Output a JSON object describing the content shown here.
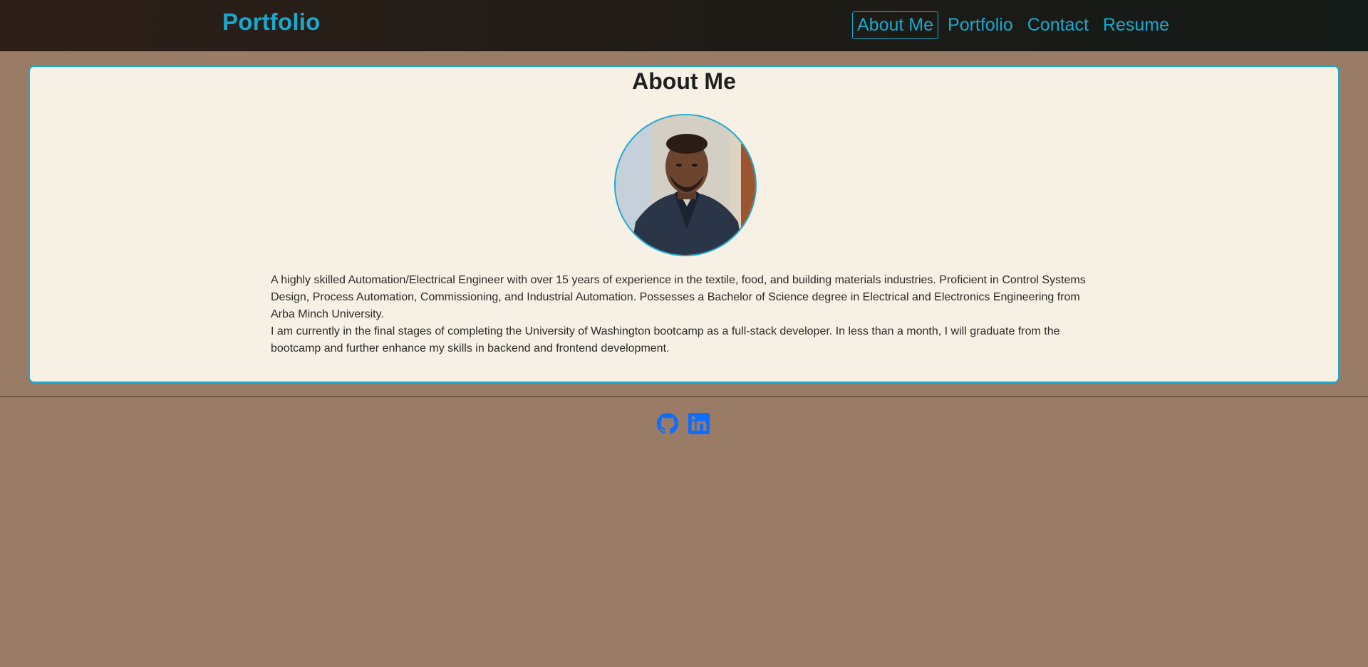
{
  "nav": {
    "brand": "Portfolio",
    "links": [
      {
        "label": "About Me",
        "active": true
      },
      {
        "label": "Portfolio",
        "active": false
      },
      {
        "label": "Contact",
        "active": false
      },
      {
        "label": "Resume",
        "active": false
      }
    ]
  },
  "about": {
    "title": "About Me",
    "avatar": "profile-photo",
    "paragraphs": [
      "A highly skilled Automation/Electrical Engineer with over 15 years of experience in the textile, food, and building materials industries. Proficient in Control Systems Design, Process Automation, Commissioning, and Industrial Automation. Possesses a Bachelor of Science degree in Electrical and Electronics Engineering from Arba Minch University.",
      "I am currently in the final stages of completing the University of Washington bootcamp as a full-stack developer. In less than a month, I will graduate from the bootcamp and further enhance my skills in backend and frontend development."
    ]
  },
  "footer": {
    "icons": [
      "github-icon",
      "linkedin-icon"
    ]
  },
  "colors": {
    "accent": "#17a9cf",
    "page_bg": "#9a7b66",
    "card_bg": "#f7f0e4",
    "social_icon": "#0d6efd"
  }
}
